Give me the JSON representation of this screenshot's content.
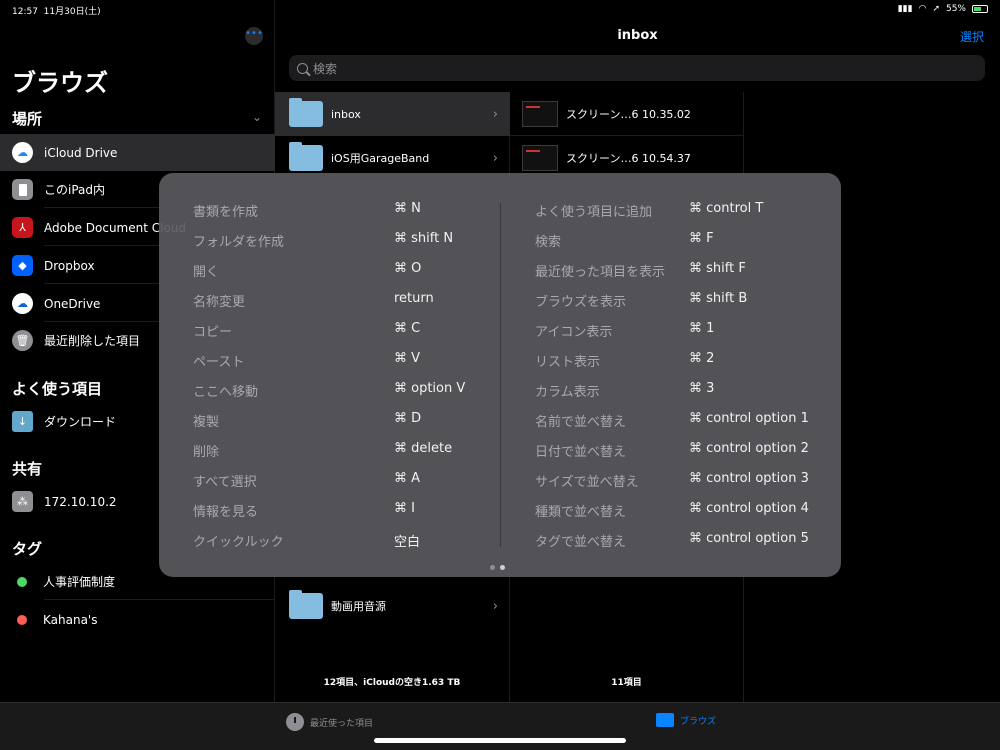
{
  "status": {
    "time": "12:57",
    "date": "11月30日(土)",
    "battery": "55%"
  },
  "sidebar": {
    "title": "ブラウズ",
    "locations_header": "場所",
    "locations": [
      {
        "label": "iCloud Drive",
        "icon": "icloud-icon",
        "selected": true
      },
      {
        "label": "このiPad内",
        "icon": "ipad-icon"
      },
      {
        "label": "Adobe Document Cloud",
        "icon": "adobe-icon"
      },
      {
        "label": "Dropbox",
        "icon": "dropbox-icon"
      },
      {
        "label": "OneDrive",
        "icon": "onedrive-icon"
      },
      {
        "label": "最近削除した項目",
        "icon": "trash-icon"
      }
    ],
    "favorites_header": "よく使う項目",
    "favorites": [
      {
        "label": "ダウンロード",
        "icon": "download-folder-icon"
      }
    ],
    "shared_header": "共有",
    "shared": [
      {
        "label": "172.10.10.2",
        "icon": "server-icon"
      }
    ],
    "tags_header": "タグ",
    "tags": [
      {
        "label": "人事評価制度",
        "color": "#4cd964"
      },
      {
        "label": "Kahana's",
        "color": "#ff5f57"
      }
    ]
  },
  "main": {
    "title": "inbox",
    "select_label": "選択",
    "search_placeholder": "検索",
    "folders": [
      {
        "label": "inbox",
        "selected": true
      },
      {
        "label": "iOS用GarageBand"
      },
      {
        "label": "動画用音源"
      }
    ],
    "col1_footer": "12項目、iCloudの空き1.63 TB",
    "files": [
      {
        "label": "スクリーン…6 10.35.02"
      },
      {
        "label": "スクリーン…6 10.54.37"
      }
    ],
    "col2_footer": "11項目"
  },
  "tabbar": {
    "recent_label": "最近使った項目",
    "browse_label": "ブラウズ"
  },
  "shortcuts": {
    "left": [
      {
        "label": "書類を作成",
        "key": "⌘  N"
      },
      {
        "label": "フォルダを作成",
        "key": "⌘  shift N"
      },
      {
        "label": "開く",
        "key": "⌘  O"
      },
      {
        "label": "名称変更",
        "key": "return"
      },
      {
        "label": "コピー",
        "key": "⌘  C"
      },
      {
        "label": "ペースト",
        "key": "⌘  V"
      },
      {
        "label": "ここへ移動",
        "key": "⌘  option V"
      },
      {
        "label": "複製",
        "key": "⌘  D"
      },
      {
        "label": "削除",
        "key": "⌘  delete"
      },
      {
        "label": "すべて選択",
        "key": "⌘  A"
      },
      {
        "label": "情報を見る",
        "key": "⌘  I"
      },
      {
        "label": "クイックルック",
        "key": "空白"
      }
    ],
    "right": [
      {
        "label": "よく使う項目に追加",
        "key": "⌘  control T"
      },
      {
        "label": "検索",
        "key": "⌘  F"
      },
      {
        "label": "最近使った項目を表示",
        "key": "⌘  shift F"
      },
      {
        "label": "ブラウズを表示",
        "key": "⌘  shift B"
      },
      {
        "label": "アイコン表示",
        "key": "⌘  1"
      },
      {
        "label": "リスト表示",
        "key": "⌘  2"
      },
      {
        "label": "カラム表示",
        "key": "⌘  3"
      },
      {
        "label": "名前で並べ替え",
        "key": "⌘  control option 1"
      },
      {
        "label": "日付で並べ替え",
        "key": "⌘  control option 2"
      },
      {
        "label": "サイズで並べ替え",
        "key": "⌘  control option 3"
      },
      {
        "label": "種類で並べ替え",
        "key": "⌘  control option 4"
      },
      {
        "label": "タグで並べ替え",
        "key": "⌘  control option 5"
      }
    ]
  }
}
